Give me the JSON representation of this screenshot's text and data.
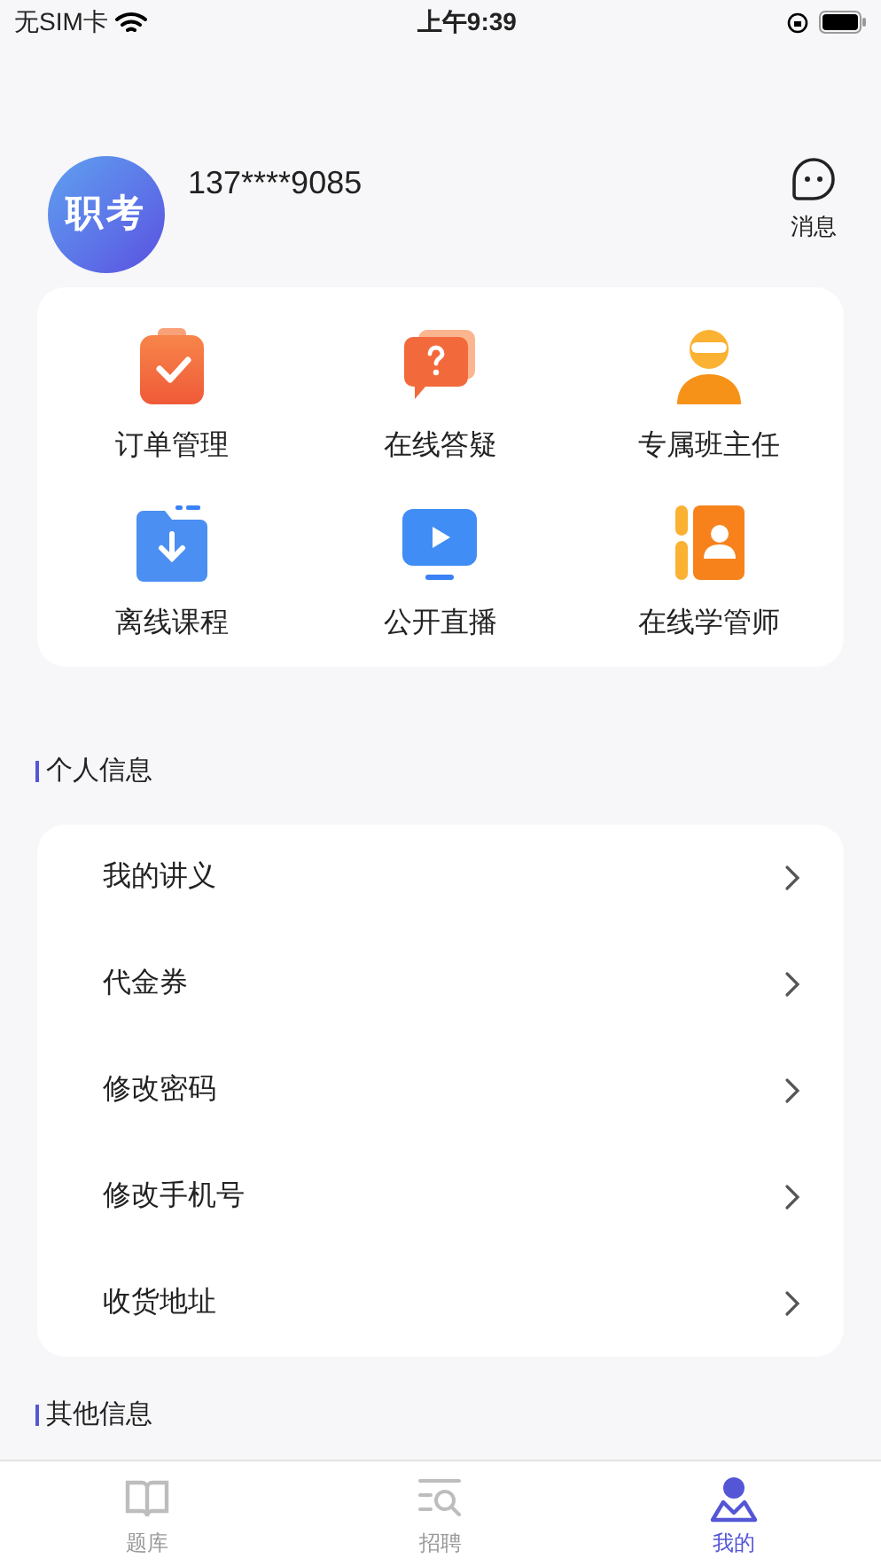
{
  "status_bar": {
    "carrier": "无SIM卡",
    "time": "上午9:39"
  },
  "profile": {
    "avatar_text": "职考",
    "phone": "137****9085",
    "messages_label": "消息"
  },
  "shortcuts": [
    {
      "label": "订单管理"
    },
    {
      "label": "在线答疑"
    },
    {
      "label": "专属班主任"
    },
    {
      "label": "离线课程"
    },
    {
      "label": "公开直播"
    },
    {
      "label": "在线学管师"
    }
  ],
  "personal_section": {
    "title": "个人信息",
    "items": [
      {
        "label": "我的讲义"
      },
      {
        "label": "代金券"
      },
      {
        "label": "修改密码"
      },
      {
        "label": "修改手机号"
      },
      {
        "label": "收货地址"
      }
    ]
  },
  "other_section": {
    "title": "其他信息"
  },
  "tab_bar": [
    {
      "label": "题库",
      "selected": false
    },
    {
      "label": "招聘",
      "selected": false
    },
    {
      "label": "我的",
      "selected": true
    }
  ]
}
